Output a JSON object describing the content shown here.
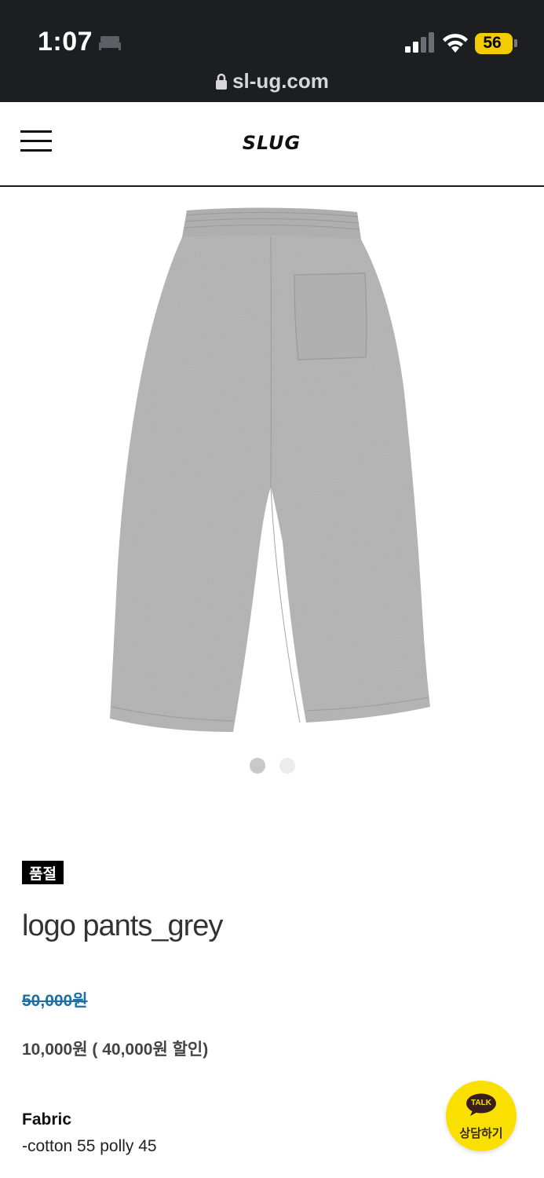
{
  "status_bar": {
    "time": "1:07",
    "battery_level": "56",
    "url": "sl-ug.com",
    "icons": [
      "sleep-icon",
      "signal-icon",
      "wifi-icon",
      "battery-icon",
      "lock-icon"
    ]
  },
  "header": {
    "menu_icon": "hamburger-menu-icon",
    "logo_text": "SLUG"
  },
  "gallery": {
    "image": "grey-sweatpants-back-view",
    "slide_count": 2,
    "active_slide": 1
  },
  "product": {
    "badge": "품절",
    "title": "logo pants_grey",
    "original_price": "50,000원",
    "sale_price": "10,000원 ( 40,000원 할인)",
    "fabric_label": "Fabric",
    "fabric_value": "-cotton 55 polly 45"
  },
  "talk_button": {
    "bubble_text": "TALK",
    "label": "상담하기"
  },
  "colors": {
    "status_bar_bg": "#1c1e21",
    "price_strike": "#1d6fa8",
    "talk_yellow": "#f9e000",
    "battery_yellow": "#f2cc00"
  }
}
